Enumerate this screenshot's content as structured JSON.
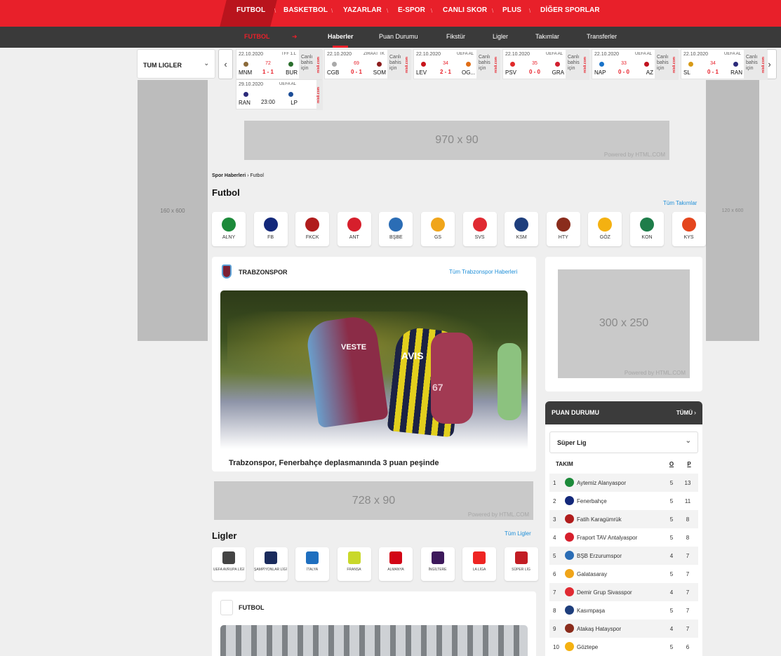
{
  "topnav": [
    "FUTBOL",
    "BASKETBOL",
    "YAZARLAR",
    "E-SPOR",
    "CANLI SKOR",
    "PLUS",
    "DİĞER SPORLAR"
  ],
  "subnav": {
    "section": "FUTBOL",
    "arrow": "➜",
    "items": [
      "Haberler",
      "Puan Durumu",
      "Fikstür",
      "Ligler",
      "Takımlar",
      "Transferler"
    ]
  },
  "side_ads": {
    "left": "160 x 600",
    "right": "120 x 600"
  },
  "league_selector": "TUM LIGLER",
  "matches": [
    {
      "date": "22.10.2020",
      "comp": "TFF 1.L",
      "minute": "72",
      "home": "MNM",
      "away": "BUR",
      "score": "1 - 1",
      "bet": "Canlı bahis için",
      "brand": "misli.com",
      "live": true,
      "hc": "#8b6a3a",
      "ac": "#2a6e2d"
    },
    {
      "date": "22.10.2020",
      "comp": "ZİRAAT TK",
      "minute": "69",
      "home": "CGB",
      "away": "SOM",
      "score": "0 - 1",
      "bet": "Canlı bahis için",
      "brand": "misli.com",
      "live": true,
      "hc": "#a9a9a9",
      "ac": "#8c1d1d"
    },
    {
      "date": "22.10.2020",
      "comp": "UEFA AL",
      "minute": "34",
      "home": "LEV",
      "away": "OG...",
      "score": "2 - 1",
      "bet": "Canlı bahis için",
      "brand": "misli.com",
      "live": true,
      "hc": "#c8151b",
      "ac": "#e06d16"
    },
    {
      "date": "22.10.2020",
      "comp": "UEFA AL",
      "minute": "35",
      "home": "PSV",
      "away": "GRA",
      "score": "0 - 0",
      "bet": "Canlı bahis için",
      "brand": "misli.com",
      "live": true,
      "hc": "#e02a2a",
      "ac": "#d21f2f"
    },
    {
      "date": "22.10.2020",
      "comp": "UEFA AL",
      "minute": "33",
      "home": "NAP",
      "away": "AZ",
      "score": "0 - 0",
      "bet": "Canlı bahis için",
      "brand": "misli.com",
      "live": true,
      "hc": "#1a73c9",
      "ac": "#c1121f"
    },
    {
      "date": "22.10.2020",
      "comp": "UEFA AL",
      "minute": "34",
      "home": "SL",
      "away": "RAN",
      "score": "0 - 1",
      "bet": "Canlı bahis için",
      "brand": "misli.com",
      "live": true,
      "hc": "#d79a17",
      "ac": "#2c2b7a"
    },
    {
      "date": "29.10.2020",
      "comp": "UEFA AL",
      "minute": "",
      "home": "RAN",
      "away": "LP",
      "score": "23:00",
      "bet": "",
      "brand": "misli.com",
      "live": false,
      "hc": "#2c2b7a",
      "ac": "#1c4d97"
    }
  ],
  "ads": {
    "top": "970 x 90",
    "mid": "728 x 90",
    "side": "300 x 250",
    "powered": "Powered by HTML.COM"
  },
  "breadcrumb": {
    "root": "Spor Haberleri",
    "sep": "›",
    "current": "Futbol"
  },
  "page_title": "Futbol",
  "all_teams_link": "Tüm Takımlar",
  "teams": [
    {
      "code": "ALNY",
      "color": "#1c8a3a"
    },
    {
      "code": "FB",
      "color": "#13287a"
    },
    {
      "code": "FKCK",
      "color": "#b01c1c"
    },
    {
      "code": "ANT",
      "color": "#d61f2c"
    },
    {
      "code": "BŞBE",
      "color": "#2b6db5"
    },
    {
      "code": "GS",
      "color": "#f0a51a"
    },
    {
      "code": "SVS",
      "color": "#e02a32"
    },
    {
      "code": "KSM",
      "color": "#1e3e7c"
    },
    {
      "code": "HTY",
      "color": "#8a2c1c"
    },
    {
      "code": "GÖZ",
      "color": "#f4b111"
    },
    {
      "code": "KON",
      "color": "#1e7d4a"
    },
    {
      "code": "KYS",
      "color": "#e4451d"
    }
  ],
  "news_card": {
    "team": "TRABZONSPOR",
    "all_link": "Tüm Trabzonspor Haberleri",
    "headline": "Trabzonspor, Fenerbahçe deplasmanında 3 puan peşinde",
    "photo_jersey_a": "VESTE",
    "photo_jersey_b": "AVIS",
    "photo_number": "67"
  },
  "leagues_title": "Ligler",
  "all_leagues_link": "Tüm Ligler",
  "leagues": [
    {
      "name": "UEFA AVRUPA LİGİ",
      "color": "#444"
    },
    {
      "name": "ŞAMPİYONLAR LİGİ",
      "color": "#1a2b5c"
    },
    {
      "name": "İTALYA",
      "color": "#1f6fbf"
    },
    {
      "name": "FRANSA",
      "color": "#c9d82a"
    },
    {
      "name": "ALMANYA",
      "color": "#d20515"
    },
    {
      "name": "İNGİLTERE",
      "color": "#3d195b"
    },
    {
      "name": "LA LİGA",
      "color": "#ee2523"
    },
    {
      "name": "SÜPER LİG",
      "color": "#c21d24"
    }
  ],
  "second_card": {
    "title": "FUTBOL"
  },
  "standings": {
    "title": "PUAN DURUMU",
    "all": "TÜMÜ",
    "selected": "Süper Lig",
    "col_team": "TAKIM",
    "col_o": "O",
    "col_p": "P",
    "rows": [
      {
        "rank": "1",
        "team": "Aytemiz Alanyaspor",
        "o": "5",
        "p": "13",
        "color": "#1c8a3a"
      },
      {
        "rank": "2",
        "team": "Fenerbahçe",
        "o": "5",
        "p": "11",
        "color": "#13287a"
      },
      {
        "rank": "3",
        "team": "Fatih Karagümrük",
        "o": "5",
        "p": "8",
        "color": "#b01c1c"
      },
      {
        "rank": "4",
        "team": "Fraport TAV Antalyaspor",
        "o": "5",
        "p": "8",
        "color": "#d61f2c"
      },
      {
        "rank": "5",
        "team": "BŞB Erzurumspor",
        "o": "4",
        "p": "7",
        "color": "#2b6db5"
      },
      {
        "rank": "6",
        "team": "Galatasaray",
        "o": "5",
        "p": "7",
        "color": "#f0a51a"
      },
      {
        "rank": "7",
        "team": "Demir Grup Sivasspor",
        "o": "4",
        "p": "7",
        "color": "#e02a32"
      },
      {
        "rank": "8",
        "team": "Kasımpaşa",
        "o": "5",
        "p": "7",
        "color": "#1e3e7c"
      },
      {
        "rank": "9",
        "team": "Atakaş Hatayspor",
        "o": "4",
        "p": "7",
        "color": "#8a2c1c"
      },
      {
        "rank": "10",
        "team": "Göztepe",
        "o": "5",
        "p": "6",
        "color": "#f4b111"
      }
    ]
  }
}
